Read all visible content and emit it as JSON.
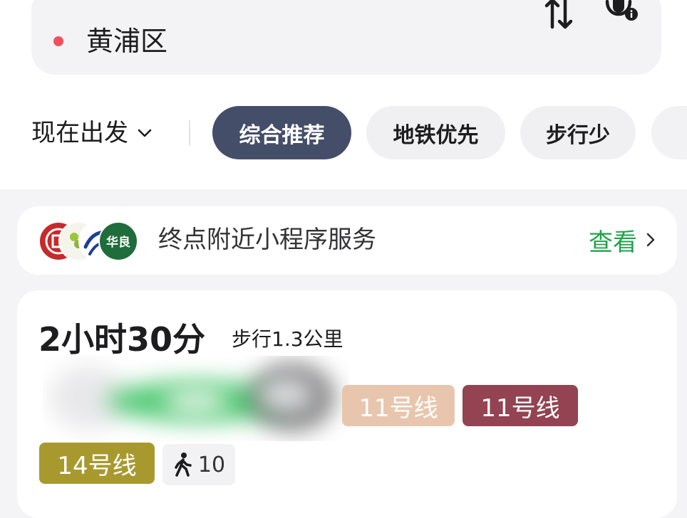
{
  "destination": {
    "name": "黄浦区"
  },
  "depart": {
    "label": "现在出发"
  },
  "filters": [
    {
      "label": "综合推荐",
      "active": true
    },
    {
      "label": "地铁优先",
      "active": false
    },
    {
      "label": "步行少",
      "active": false
    }
  ],
  "mini_program": {
    "text": "终点附近小程序服务",
    "view_label": "查看",
    "logo_text": "华良"
  },
  "route": {
    "time": "2小时30分",
    "walk": "步行1.3公里",
    "segments": [
      {
        "label": "11号线",
        "color": "#e8c6ad"
      },
      {
        "label": "11号线",
        "color": "#934352"
      },
      {
        "label": "14号线",
        "color": "#a8992f"
      }
    ],
    "walk_count": "10"
  },
  "colors": {
    "accent_active_chip": "#454e68",
    "link_green": "#1fa34a",
    "dest_dot": "#f0505d"
  }
}
